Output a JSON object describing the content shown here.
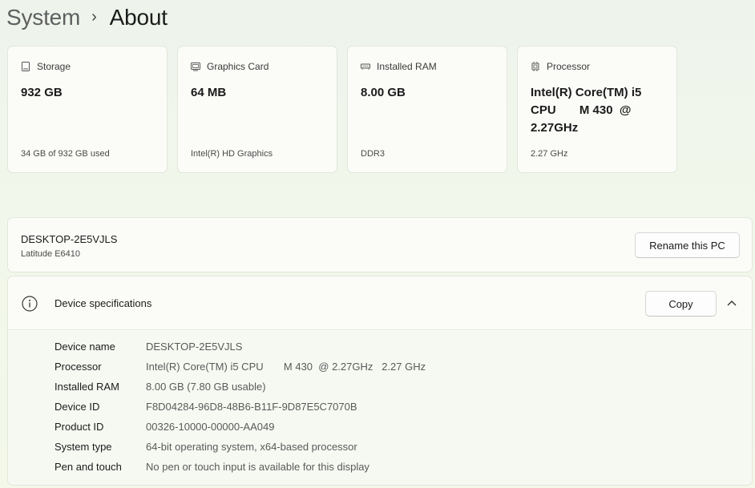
{
  "breadcrumb": {
    "parent": "System",
    "separator": "›",
    "current": "About"
  },
  "cards": [
    {
      "label": "Storage",
      "value": "932 GB",
      "sub": "34 GB of 932 GB used",
      "icon": "storage-icon"
    },
    {
      "label": "Graphics Card",
      "value": "64 MB",
      "sub": "Intel(R) HD Graphics",
      "icon": "graphics-card-icon"
    },
    {
      "label": "Installed RAM",
      "value": "8.00 GB",
      "sub": "DDR3",
      "icon": "ram-icon"
    },
    {
      "label": "Processor",
      "value": "Intel(R) Core(TM) i5\nCPU       M 430  @\n2.27GHz",
      "sub": "2.27 GHz",
      "icon": "processor-icon"
    }
  ],
  "pc": {
    "name": "DESKTOP-2E5VJLS",
    "model": "Latitude E6410",
    "rename_label": "Rename this PC"
  },
  "specs": {
    "title": "Device specifications",
    "copy_label": "Copy",
    "rows": [
      {
        "key": "Device name",
        "value": "DESKTOP-2E5VJLS"
      },
      {
        "key": "Processor",
        "value": "Intel(R) Core(TM) i5 CPU       M 430  @ 2.27GHz   2.27 GHz"
      },
      {
        "key": "Installed RAM",
        "value": "8.00 GB (7.80 GB usable)"
      },
      {
        "key": "Device ID",
        "value": "F8D04284-96D8-48B6-B11F-9D87E5C7070B"
      },
      {
        "key": "Product ID",
        "value": "00326-10000-00000-AA049"
      },
      {
        "key": "System type",
        "value": "64-bit operating system, x64-based processor"
      },
      {
        "key": "Pen and touch",
        "value": "No pen or touch input is available for this display"
      }
    ]
  }
}
